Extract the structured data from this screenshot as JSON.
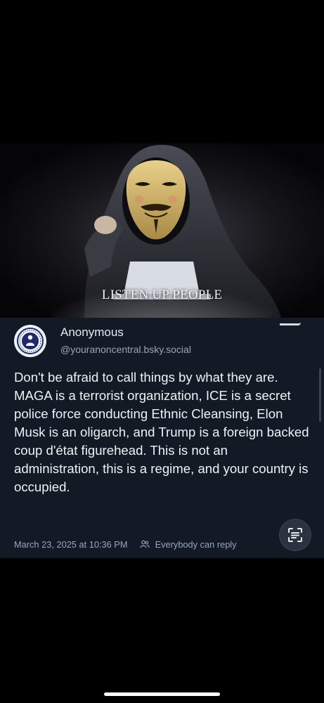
{
  "hero": {
    "caption": "LISTEN UP PEOPLE",
    "image": "hooded-figure-guy-fawkes-mask-laptop"
  },
  "post": {
    "author_name": "Anonymous",
    "author_handle": "@youranoncentral.bsky.social",
    "avatar_icon": "anonymous-emblem-icon",
    "text": "Don't be afraid to call things by what they are. MAGA is a terrorist organization, ICE is a secret police force conducting Ethnic Cleansing, Elon Musk is an oligarch, and Trump is a foreign backed coup d'état figurehead. This is not an administration, this is a regime, and your country is occupied.",
    "timestamp": "March 23, 2025 at 10:36 PM",
    "reply_setting": "Everybody can reply",
    "colors": {
      "card_bg": "#111a25",
      "text": "#eef2f6",
      "muted": "#9aa7b5"
    }
  },
  "icons": {
    "scan": "text-scan-icon",
    "people": "people-icon"
  }
}
